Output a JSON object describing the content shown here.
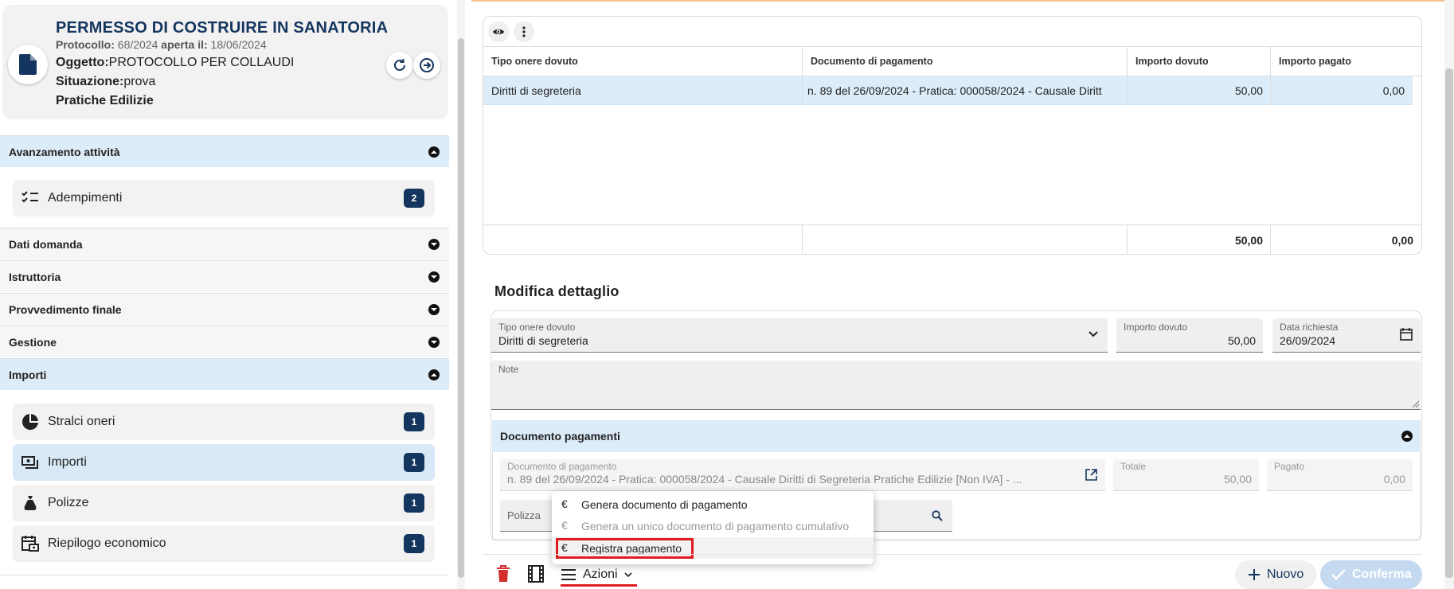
{
  "header": {
    "title": "PERMESSO DI COSTRUIRE IN SANATORIA",
    "protocollo_label": "Protocollo:",
    "protocollo_value": "68/2024",
    "aperta_label": "aperta il:",
    "aperta_value": "18/06/2024",
    "oggetto_label": "Oggetto:",
    "oggetto_value": "PROTOCOLLO PER COLLAUDI",
    "situazione_label": "Situazione:",
    "situazione_value": "prova",
    "tipo": "Pratiche Edilizie"
  },
  "sidebar": {
    "sections": [
      {
        "label": "Avanzamento attività"
      },
      {
        "label": "Dati domanda"
      },
      {
        "label": "Istruttoria"
      },
      {
        "label": "Provvedimento finale"
      },
      {
        "label": "Gestione"
      },
      {
        "label": "Importi"
      }
    ],
    "avanzamento_items": [
      {
        "label": "Adempimenti",
        "count": "2",
        "icon": "checklist-icon"
      }
    ],
    "importi_items": [
      {
        "label": "Stralci oneri",
        "count": "1",
        "icon": "pie-chart-icon"
      },
      {
        "label": "Importi",
        "count": "1",
        "icon": "payments-icon"
      },
      {
        "label": "Polizze",
        "count": "1",
        "icon": "money-bag-icon"
      },
      {
        "label": "Riepilogo economico",
        "count": "1",
        "icon": "calendar-money-icon"
      }
    ]
  },
  "table": {
    "columns": [
      "Tipo onere dovuto",
      "Documento di pagamento",
      "Importo dovuto",
      "Importo pagato"
    ],
    "rows": [
      {
        "tipo": "Diritti di segreteria",
        "documento": "n. 89 del 26/09/2024 - Pratica: 000058/2024 - Causale Diritt",
        "dovuto": "50,00",
        "pagato": "0,00"
      }
    ],
    "totals": {
      "dovuto": "50,00",
      "pagato": "0,00"
    }
  },
  "detail": {
    "section_title": "Modifica dettaglio",
    "tipo_label": "Tipo onere dovuto",
    "tipo_value": "Diritti di segreteria",
    "importo_label": "Importo dovuto",
    "importo_value": "50,00",
    "data_label": "Data richiesta",
    "data_value": "26/09/2024",
    "note_label": "Note",
    "doc_section": "Documento pagamenti",
    "doc_label": "Documento di pagamento",
    "doc_value": "n. 89 del 26/09/2024 - Pratica: 000058/2024 - Causale Diritti di Segreteria Pratiche Edilizie [Non IVA] - ...",
    "totale_label": "Totale",
    "totale_value": "50,00",
    "pagato_label": "Pagato",
    "pagato_value": "0,00",
    "polizza_label": "Polizza"
  },
  "menu": {
    "items": [
      {
        "label": "Genera documento di pagamento",
        "disabled": false
      },
      {
        "label": "Genera un unico documento di pagamento cumulativo",
        "disabled": true
      },
      {
        "label": "Registra pagamento",
        "disabled": false
      }
    ]
  },
  "toolbar": {
    "azioni_label": "Azioni",
    "nuovo_label": "Nuovo",
    "conferma_label": "Conferma"
  },
  "colors": {
    "brand": "#14355e",
    "selected_row": "#dcecf9",
    "highlight": "#e21b23",
    "delete": "#d32f2f"
  }
}
